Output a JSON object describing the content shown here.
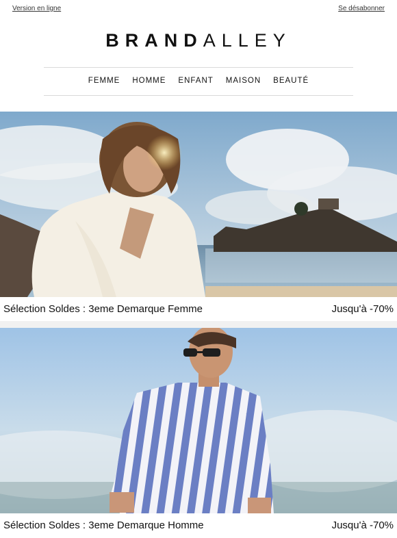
{
  "top_links": {
    "online_version": "Version en ligne",
    "unsubscribe": "Se désabonner"
  },
  "brand": {
    "bold_part": "BRAND",
    "light_part": "ALLEY"
  },
  "nav": [
    "FEMME",
    "HOMME",
    "ENFANT",
    "MAISON",
    "BEAUTÉ"
  ],
  "banners": [
    {
      "title": "Sélection Soldes : 3eme Demarque Femme",
      "promo": "Jusqu'à -70%"
    },
    {
      "title": "Sélection Soldes : 3eme Demarque Homme",
      "promo": "Jusqu'à -70%"
    }
  ]
}
